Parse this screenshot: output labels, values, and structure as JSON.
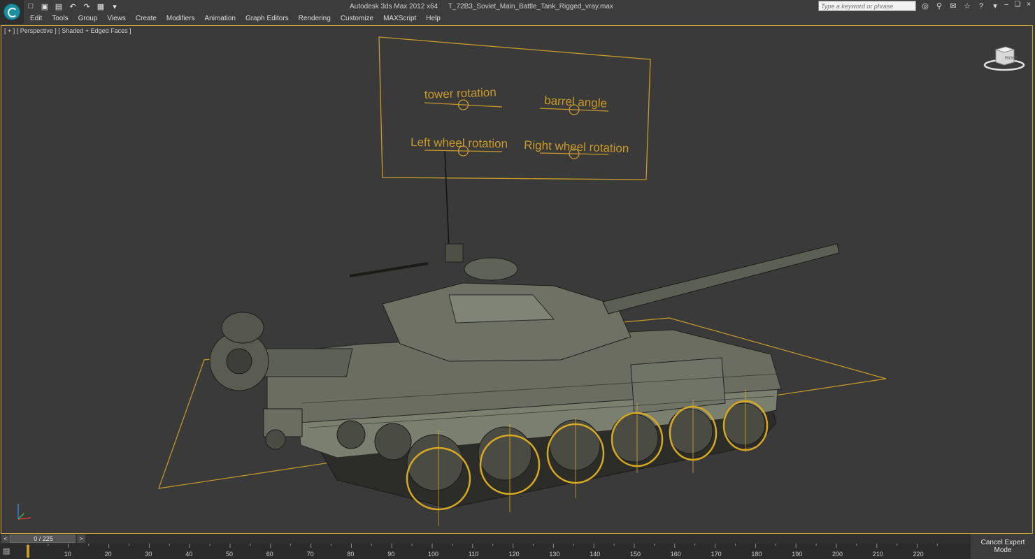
{
  "window": {
    "app_name": "Autodesk 3ds Max  2012 x64",
    "file_name": "T_72B3_Soviet_Main_Battle_Tank_Rigged_vray.max"
  },
  "quick_access": [
    {
      "name": "new-file-icon",
      "glyph": "□"
    },
    {
      "name": "open-file-icon",
      "glyph": "▣"
    },
    {
      "name": "save-file-icon",
      "glyph": "▤"
    },
    {
      "name": "undo-icon",
      "glyph": "↶"
    },
    {
      "name": "redo-icon",
      "glyph": "↷"
    },
    {
      "name": "project-folder-icon",
      "glyph": "▦"
    },
    {
      "name": "dropdown-arrow-icon",
      "glyph": "▾"
    }
  ],
  "menu": [
    "Edit",
    "Tools",
    "Group",
    "Views",
    "Create",
    "Modifiers",
    "Animation",
    "Graph Editors",
    "Rendering",
    "Customize",
    "MAXScript",
    "Help"
  ],
  "search": {
    "placeholder": "Type a keyword or phrase"
  },
  "toolbar_icons": [
    "binoculars-icon",
    "key-icon",
    "communication-center-icon",
    "favorites-star-icon",
    "help-icon"
  ],
  "viewport": {
    "label": "[ + ] [ Perspective ] [ Shaded + Edged Faces ]",
    "viewcube_label": "RIGHT"
  },
  "controls_panel": {
    "sliders": [
      {
        "label": "tower rotation",
        "value": 0.5
      },
      {
        "label": "barrel angle",
        "value": 0.5
      },
      {
        "label": "Left wheel rotation",
        "value": 0.5
      },
      {
        "label": "Right wheel rotation",
        "value": 0.5
      }
    ]
  },
  "timeline": {
    "counter": "0 / 225",
    "prev": "<",
    "next": ">",
    "current_frame": 0,
    "total_frames": 225,
    "ruler_ticks": [
      10,
      20,
      30,
      40,
      50,
      60,
      70,
      80,
      90,
      100,
      110,
      120,
      130,
      140,
      150,
      160,
      170,
      180,
      190,
      200,
      210,
      220
    ]
  },
  "status": {
    "expert_mode": "Cancel Expert Mode"
  },
  "colors": {
    "accent": "#c99a2a",
    "viewport_bg": "#3a3a3a",
    "model": "#7b7f70"
  }
}
